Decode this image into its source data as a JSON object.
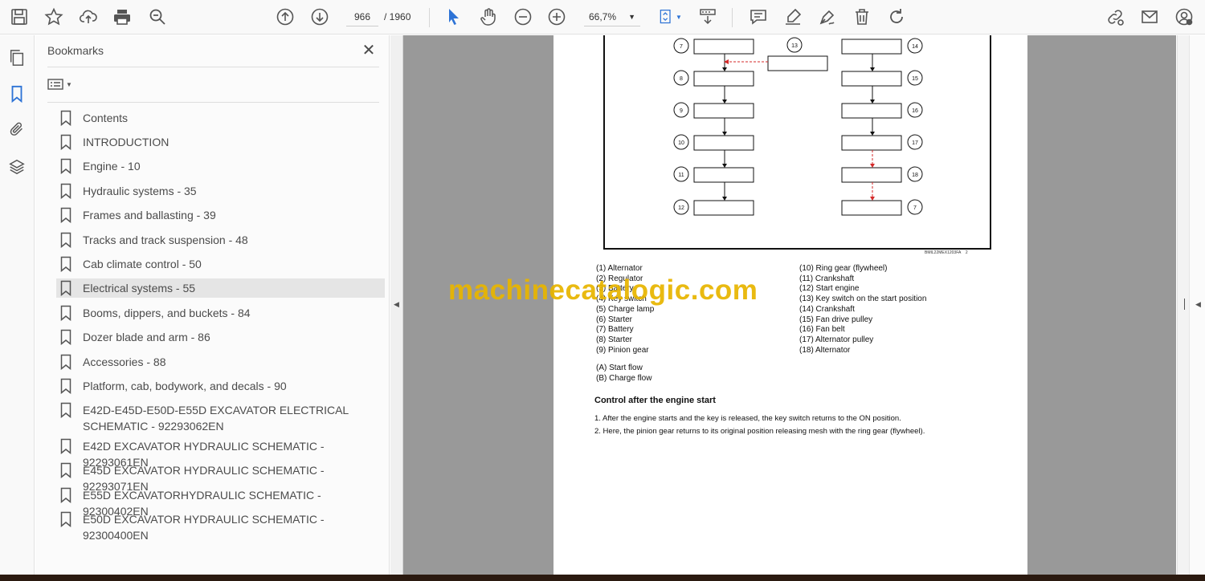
{
  "toolbar": {
    "page_current": "966",
    "page_total": "/ 1960",
    "zoom": "66,7%"
  },
  "left_rail": {
    "icons": [
      "pages-icon",
      "bookmark-icon",
      "attachment-icon",
      "layers-icon"
    ]
  },
  "bookmarks": {
    "title": "Bookmarks",
    "close": "✕",
    "items": [
      {
        "label": "Contents"
      },
      {
        "label": "INTRODUCTION"
      },
      {
        "label": "Engine - 10"
      },
      {
        "label": "Hydraulic systems - 35"
      },
      {
        "label": "Frames and ballasting - 39"
      },
      {
        "label": "Tracks and track suspension - 48"
      },
      {
        "label": "Cab climate control - 50"
      },
      {
        "label": "Electrical systems - 55",
        "selected": true
      },
      {
        "label": "Booms, dippers, and buckets - 84"
      },
      {
        "label": "Dozer blade and arm - 86"
      },
      {
        "label": "Accessories - 88"
      },
      {
        "label": "Platform, cab, bodywork, and decals - 90"
      },
      {
        "label": "E42D-E45D-E50D-E55D EXCAVATOR ELECTRICAL SCHEMATIC - 92293062EN"
      },
      {
        "label": "E42D EXCAVATOR HYDRAULIC SCHEMATIC - 92293061EN"
      },
      {
        "label": "E45D EXCAVATOR HYDRAULIC SCHEMATIC - 92293071EN"
      },
      {
        "label": "E55D EXCAVATORHYDRAULIC SCHEMATIC - 92300402EN"
      },
      {
        "label": "E50D EXCAVATOR HYDRAULIC SCHEMATIC - 92300400EN"
      }
    ]
  },
  "document": {
    "figure": {
      "code": "BMIL22MEX1203FA",
      "number": "2",
      "left_column_numbers": [
        "7",
        "8",
        "9",
        "10",
        "11",
        "12"
      ],
      "middle_number": "13",
      "right_column_numbers": [
        "14",
        "15",
        "16",
        "17",
        "18",
        "7"
      ]
    },
    "legend_left": [
      "(1) Alternator",
      "(2) Regulator",
      "(3) Battery",
      "(4) Key switch",
      "(5) Charge lamp",
      "(6) Starter",
      "(7) Battery",
      "(8) Starter",
      "(9) Pinion gear"
    ],
    "legend_right": [
      "(10) Ring gear (flywheel)",
      "(11) Crankshaft",
      "(12) Start engine",
      "(13) Key switch on the start position",
      "(14) Crankshaft",
      "(15) Fan drive pulley",
      "(16) Fan belt",
      "(17) Alternator pulley",
      "(18) Alternator"
    ],
    "flows": [
      "(A) Start flow",
      "(B) Charge flow"
    ],
    "section_heading": "Control after the engine start",
    "steps": [
      "1.  After the engine starts and the key is released, the key switch returns to the ON position.",
      "2.  Here, the pinion gear returns to its original position releasing mesh with the ring gear (flywheel)."
    ],
    "watermark": "machinecatalogic.com"
  },
  "colors": {
    "accent": "#2d73d6",
    "viewer_bg": "#999999",
    "watermark": "#e8b500",
    "dashed_arrow": "#d42a2a"
  }
}
